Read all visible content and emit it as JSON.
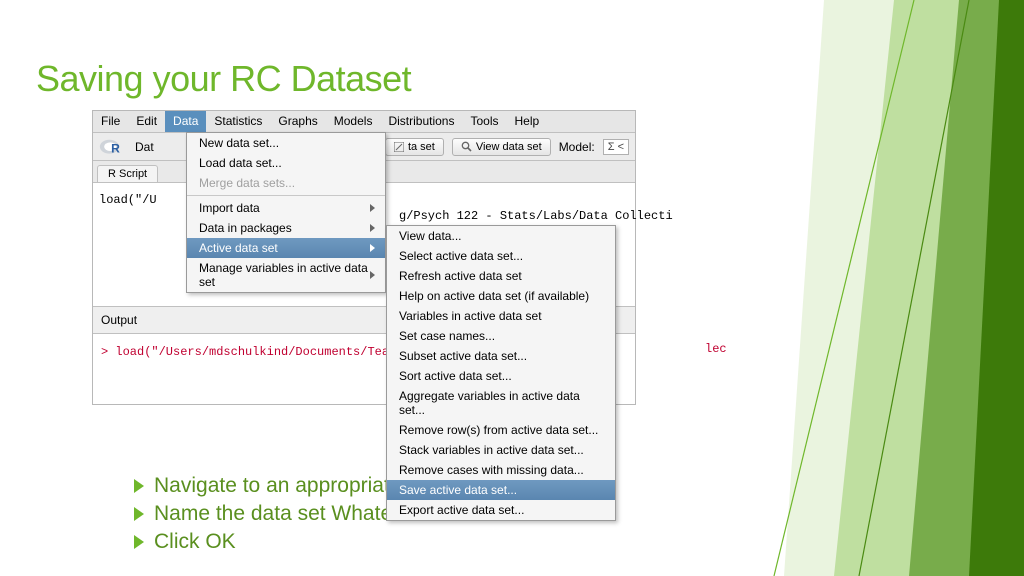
{
  "title": "Saving your RC Dataset",
  "menubar": {
    "items": [
      "File",
      "Edit",
      "Data",
      "Statistics",
      "Graphs",
      "Models",
      "Distributions",
      "Tools",
      "Help"
    ],
    "active_index": 2
  },
  "toolbar": {
    "data_set_label": "Dat",
    "edit_button_partial": "ta set",
    "view_button": "View data set",
    "model_label": "Model:",
    "model_value": "Σ  <"
  },
  "tab": "R Script",
  "editor": {
    "visible_left": "load(\"/U",
    "visible_right": "g/Psych 122 - Stats/Labs/Data Collecti"
  },
  "output": {
    "label": "Output",
    "line_left": "> load(\"/Users/mdschulkind/Documents/Teac",
    "line_right": "lec"
  },
  "menu_data": {
    "items": [
      {
        "label": "New data set...",
        "sub": false
      },
      {
        "label": "Load data set...",
        "sub": false
      },
      {
        "label": "Merge data sets...",
        "sub": false,
        "disabled": true
      },
      {
        "sep": true
      },
      {
        "label": "Import data",
        "sub": true
      },
      {
        "label": "Data in packages",
        "sub": true
      },
      {
        "label": "Active data set",
        "sub": true,
        "selected": true
      },
      {
        "label": "Manage variables in active data set",
        "sub": true
      }
    ]
  },
  "submenu_active": {
    "items": [
      {
        "label": "View data..."
      },
      {
        "label": "Select active data set..."
      },
      {
        "label": "Refresh active data set"
      },
      {
        "label": "Help on active data set (if available)"
      },
      {
        "label": "Variables in active data set"
      },
      {
        "label": "Set case names..."
      },
      {
        "label": "Subset active data set..."
      },
      {
        "label": "Sort active data set..."
      },
      {
        "label": "Aggregate variables in active data set..."
      },
      {
        "label": "Remove row(s) from active data set..."
      },
      {
        "label": "Stack variables in active data set..."
      },
      {
        "label": "Remove cases with missing data..."
      },
      {
        "label": "Save active data set...",
        "selected": true
      },
      {
        "label": "Export active data set..."
      }
    ]
  },
  "bullets": [
    "Navigate to an appropriate location",
    "Name the data set WhateverYouWant",
    "Click OK"
  ]
}
